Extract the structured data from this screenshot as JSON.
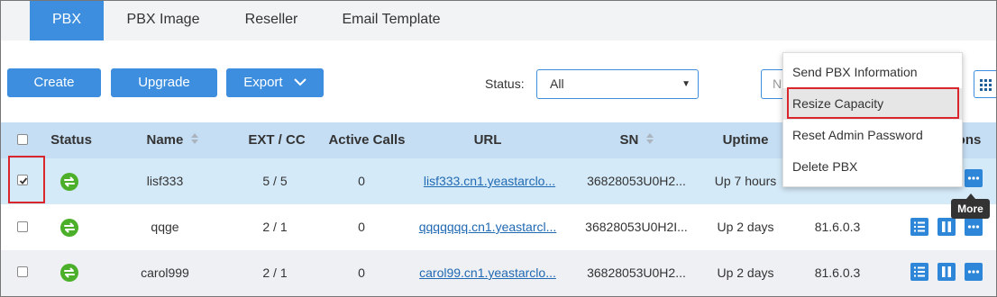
{
  "tabs": [
    "PBX",
    "PBX Image",
    "Reseller",
    "Email Template"
  ],
  "toolbar": {
    "create_label": "Create",
    "upgrade_label": "Upgrade",
    "export_label": "Export",
    "status_label": "Status:",
    "status_value": "All",
    "search_placeholder": "N"
  },
  "table": {
    "headers": {
      "status": "Status",
      "name": "Name",
      "ext_cc": "EXT / CC",
      "active_calls": "Active Calls",
      "url": "URL",
      "sn": "SN",
      "uptime": "Uptime",
      "operations": "ons"
    },
    "rows": [
      {
        "name": "lisf333",
        "ext_cc": "5 / 5",
        "active_calls": "0",
        "url": "lisf333.cn1.yeastarclo...",
        "sn": "36828053U0H2...",
        "uptime": "Up 7 hours",
        "version": "",
        "checked": true
      },
      {
        "name": "qqge",
        "ext_cc": "2 / 1",
        "active_calls": "0",
        "url": "qqqqqqq.cn1.yeastarcl...",
        "sn": "36828053U0H2I...",
        "uptime": "Up 2 days",
        "version": "81.6.0.3",
        "checked": false
      },
      {
        "name": "carol999",
        "ext_cc": "2 / 1",
        "active_calls": "0",
        "url": "carol99.cn1.yeastarclo...",
        "sn": "36828053U0H2...",
        "uptime": "Up 2 days",
        "version": "81.6.0.3",
        "checked": false
      }
    ]
  },
  "menu": {
    "items": [
      "Send PBX Information",
      "Resize Capacity",
      "Reset Admin Password",
      "Delete PBX"
    ]
  },
  "tooltip": "More",
  "colors": {
    "accent": "#3d8ede",
    "header_bg": "#c6def4",
    "selected_row": "#d5eaf8",
    "status_green": "#4caf2a",
    "highlight_red": "#d9262c"
  }
}
